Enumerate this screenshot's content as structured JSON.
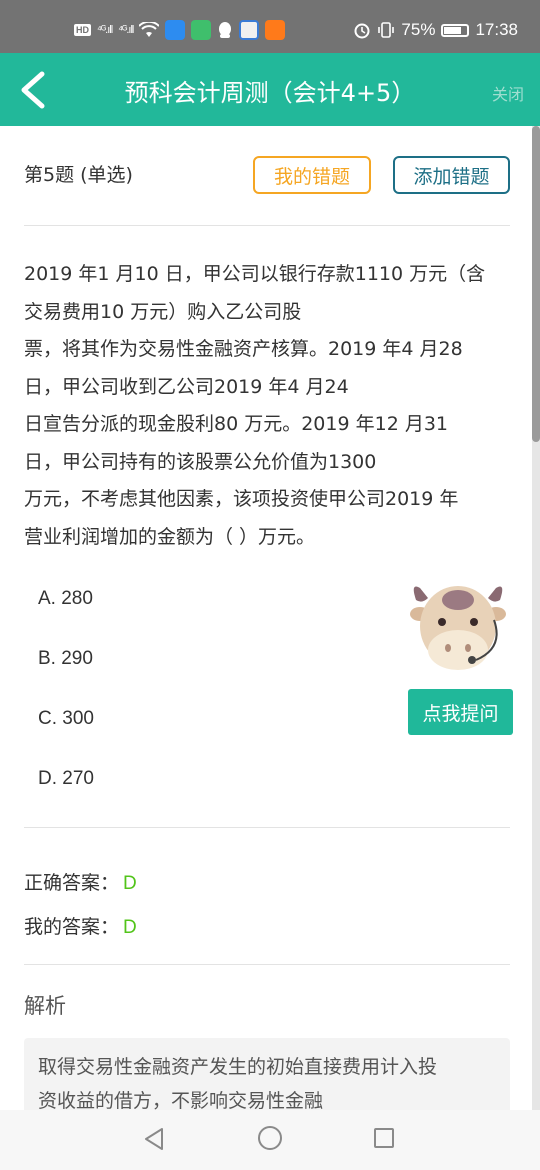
{
  "status_bar": {
    "hd": "HD",
    "signal_1": "⁴ᴳ.ıll",
    "signal_2": "⁴ᴳ.ıll",
    "battery": "75%",
    "battery_level": 0.75,
    "time": "17:38"
  },
  "header": {
    "title": "预科会计周测（会计4+5）",
    "close_label": "关闭"
  },
  "question": {
    "index_label": "第5题 (单选)",
    "my_wrong_button": "我的错题",
    "add_wrong_button": "添加错题",
    "lines": [
      "2019 年1 月10 日，甲公司以银行存款1110 万元（含",
      "交易费用10 万元）购入乙公司股",
      "票，将其作为交易性金融资产核算。2019 年4 月28",
      "日，甲公司收到乙公司2019 年4 月24",
      "日宣告分派的现金股利80 万元。2019 年12 月31",
      "日，甲公司持有的该股票公允价值为1300",
      "万元，不考虑其他因素，该项投资使甲公司2019 年",
      "营业利润增加的金额为（ ）万元。"
    ],
    "options": [
      "A. 280",
      "B. 290",
      "C. 300",
      "D. 270"
    ]
  },
  "answers": {
    "correct_label": "正确答案：",
    "correct_value": "D",
    "mine_label": "我的答案：",
    "mine_value": "D"
  },
  "analysis": {
    "title": "解析",
    "lines": [
      "取得交易性金融资产发生的初始直接费用计入投",
      "资收益的借方，不影响交易性金融"
    ]
  },
  "assistant": {
    "ask_button": "点我提问",
    "mascot_icon": "cow-mascot-icon"
  },
  "colors": {
    "header_bg": "#22b89a",
    "wrong_btn": "#f5a623",
    "add_btn": "#1d6f86",
    "answer_green": "#52c41a"
  }
}
